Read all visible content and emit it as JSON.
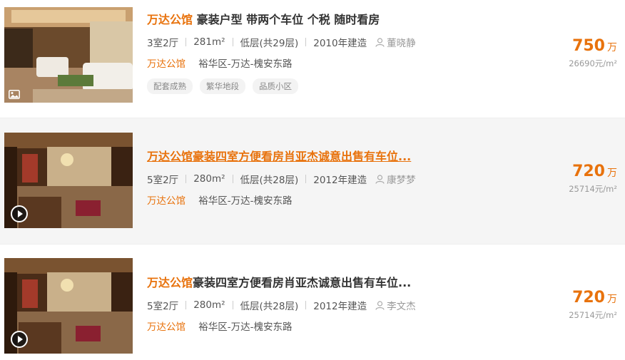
{
  "listings": [
    {
      "community": "万达公馆",
      "description": "豪装户型 带两个车位 个税 随时看房",
      "layout": "3室2厅",
      "area": "281m²",
      "floor": "低层(共29层)",
      "year": "2010年建造",
      "agent": "董晓静",
      "location_community": "万达公馆",
      "location_area": "裕华区-万达-槐安东路",
      "tags": [
        "配套成熟",
        "繁华地段",
        "品质小区"
      ],
      "total_price": "750",
      "price_unit": "万",
      "unit_price": "26690元/m²",
      "media": "image-gallery-icon"
    },
    {
      "community": "万达公馆",
      "description": "豪装四室方便看房肖亚杰诚意出售有车位...",
      "layout": "5室2厅",
      "area": "280m²",
      "floor": "低层(共28层)",
      "year": "2012年建造",
      "agent": "康梦梦",
      "location_community": "万达公馆",
      "location_area": "裕华区-万达-槐安东路",
      "total_price": "720",
      "price_unit": "万",
      "unit_price": "25714元/m²",
      "media": "video-play-icon"
    },
    {
      "community": "万达公馆",
      "description": "豪装四室方便看房肖亚杰诚意出售有车位...",
      "layout": "5室2厅",
      "area": "280m²",
      "floor": "低层(共28层)",
      "year": "2012年建造",
      "agent": "李文杰",
      "location_community": "万达公馆",
      "location_area": "裕华区-万达-槐安东路",
      "total_price": "720",
      "price_unit": "万",
      "unit_price": "25714元/m²",
      "media": "video-play-icon"
    }
  ],
  "colors": {
    "accent": "#e8720c",
    "hover_background": "#f5f5f5",
    "muted_text": "#999999"
  }
}
